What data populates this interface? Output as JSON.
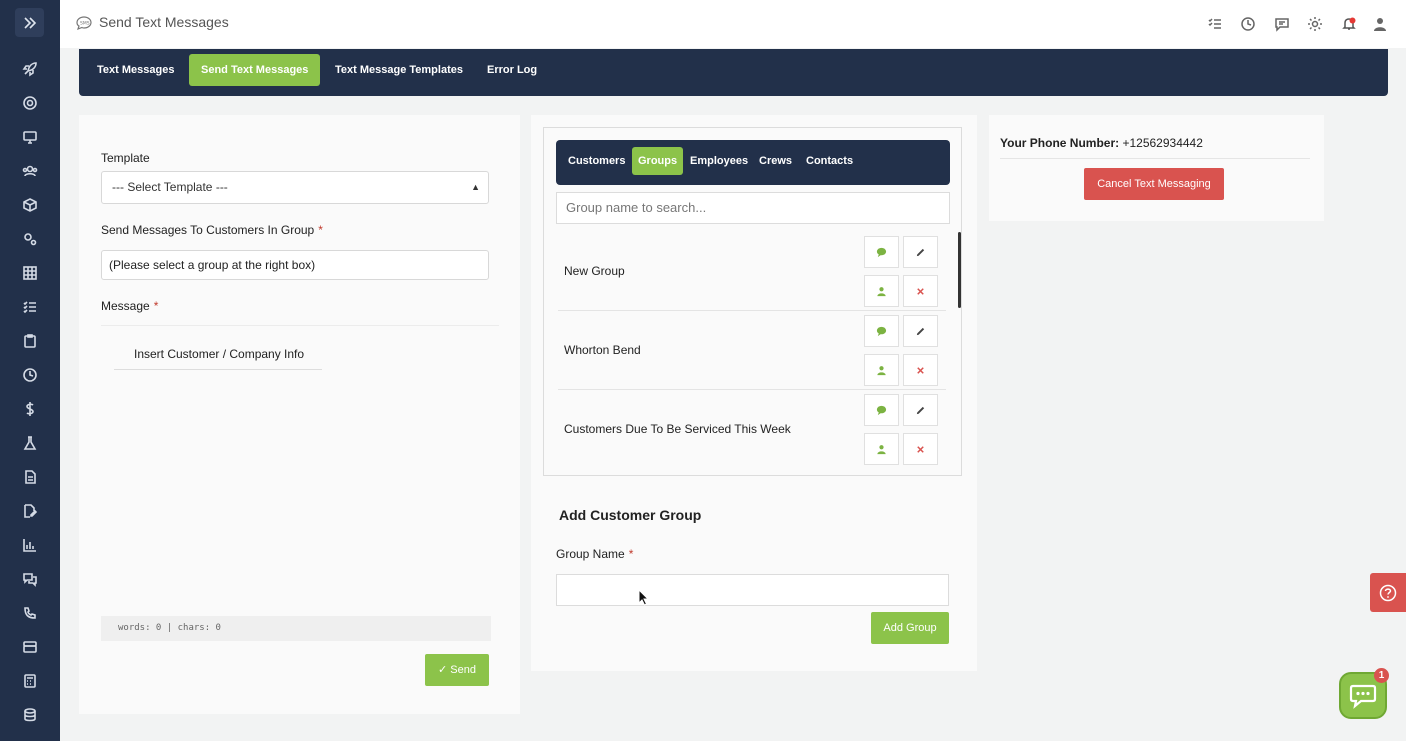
{
  "header": {
    "title": "Send Text Messages"
  },
  "tabs": [
    {
      "label": "Text Messages",
      "active": false
    },
    {
      "label": "Send Text Messages",
      "active": true
    },
    {
      "label": "Text Message Templates",
      "active": false
    },
    {
      "label": "Error Log",
      "active": false
    }
  ],
  "left": {
    "template_label": "Template",
    "template_value": "--- Select Template ---",
    "group_label": "Send Messages To Customers In Group",
    "group_value": "(Please select a group at the right box)",
    "message_label": "Message",
    "insert_label": "Insert Customer / Company Info",
    "word_count": "words: 0 | chars: 0",
    "send_label": "Send"
  },
  "middle": {
    "subtabs": [
      {
        "label": "Customers",
        "active": false
      },
      {
        "label": "Groups",
        "active": true
      },
      {
        "label": "Employees",
        "active": false
      },
      {
        "label": "Crews",
        "active": false
      },
      {
        "label": "Contacts",
        "active": false
      }
    ],
    "search_placeholder": "Group name to search...",
    "groups": [
      {
        "name": "New Group"
      },
      {
        "name": "Whorton Bend"
      },
      {
        "name": "Customers Due To Be Serviced This Week"
      }
    ],
    "add_title": "Add Customer Group",
    "group_name_label": "Group Name",
    "add_button": "Add Group"
  },
  "right": {
    "phone_label": "Your Phone Number:",
    "phone_value": "+12562934442",
    "cancel_button": "Cancel Text Messaging"
  },
  "chat_badge": "1",
  "colors": {
    "sidebar": "#22304a",
    "accent_green": "#8cc34a",
    "danger_red": "#d9534f"
  }
}
